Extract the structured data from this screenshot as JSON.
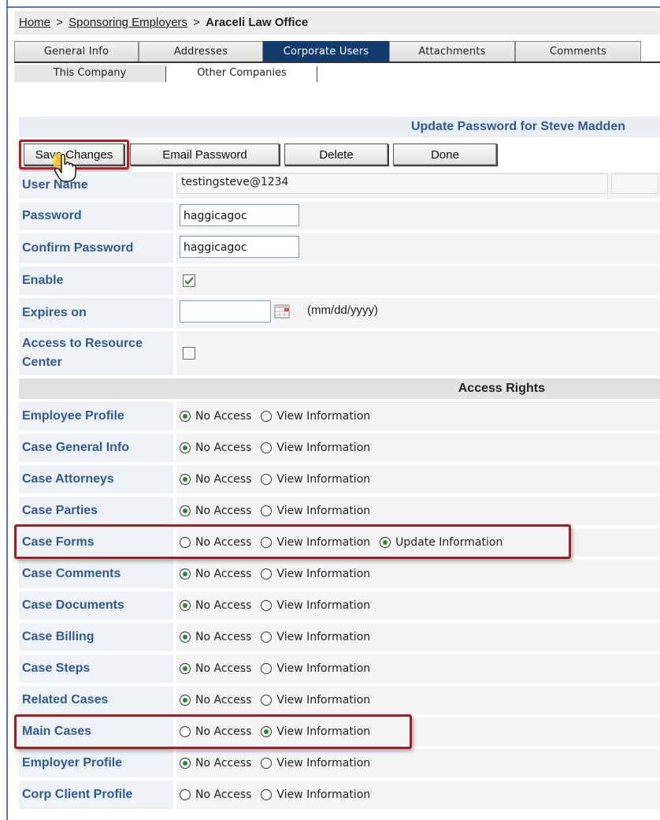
{
  "breadcrumb": {
    "home": "Home",
    "separator": ">",
    "sponsoring": "Sponsoring Employers",
    "current": "Araceli Law Office"
  },
  "tabs": [
    {
      "label": "General Info",
      "active": false
    },
    {
      "label": "Addresses",
      "active": false
    },
    {
      "label": "Corporate Users",
      "active": true
    },
    {
      "label": "Attachments",
      "active": false
    },
    {
      "label": "Comments",
      "active": false
    }
  ],
  "subtabs": [
    {
      "label": "This Company"
    },
    {
      "label": "Other Companies"
    }
  ],
  "update_header": "Update Password for Steve Madden",
  "buttons": {
    "save": "Save Changes",
    "email": "Email Password",
    "delete": "Delete",
    "done": "Done"
  },
  "form": {
    "username_label": "User Name",
    "username_value": "testingsteve@1234",
    "password_label": "Password",
    "password_value": "haggicagoc",
    "confirm_label": "Confirm Password",
    "confirm_value": "haggicagoc",
    "enable_label": "Enable",
    "enable_checked": true,
    "expires_label": "Expires on",
    "expires_value": "",
    "date_hint": "(mm/dd/yyyy)",
    "resource_label": "Access to Resource Center",
    "resource_checked": false
  },
  "access_rights_header": "Access Rights",
  "options": {
    "no_access": "No Access",
    "view_information": "View Information",
    "update_information": "Update Information"
  },
  "access_rights": [
    {
      "label": "Employee Profile",
      "selected": "no_access"
    },
    {
      "label": "Case General Info",
      "selected": "no_access"
    },
    {
      "label": "Case Attorneys",
      "selected": "no_access"
    },
    {
      "label": "Case Parties",
      "selected": "no_access"
    },
    {
      "label": "Case Forms",
      "selected": "update_information",
      "has_update": true,
      "highlighted": true
    },
    {
      "label": "Case Comments",
      "selected": "no_access"
    },
    {
      "label": "Case Documents",
      "selected": "no_access"
    },
    {
      "label": "Case Billing",
      "selected": "no_access"
    },
    {
      "label": "Case Steps",
      "selected": "no_access"
    },
    {
      "label": "Related Cases",
      "selected": "no_access"
    },
    {
      "label": "Main Cases",
      "selected": "view_information",
      "highlighted": true
    },
    {
      "label": "Employer Profile",
      "selected": "no_access"
    },
    {
      "label": "Corp Client Profile",
      "selected": "none"
    }
  ],
  "colors": {
    "label_blue": "#2f5a96",
    "active_tab": "#123c6e",
    "highlight_red": "#a31d24",
    "radio_green": "#2a8a2a"
  }
}
